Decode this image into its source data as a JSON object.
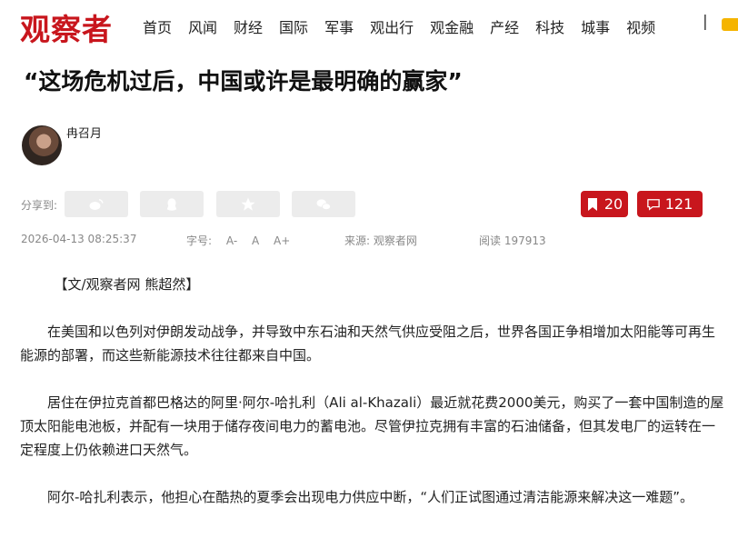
{
  "brand": {
    "logo_text": "观察者",
    "accent": "#c8161d"
  },
  "nav": {
    "items": [
      "首页",
      "风闻",
      "财经",
      "国际",
      "军事",
      "观出行",
      "观金融",
      "产经",
      "科技",
      "城事",
      "视频"
    ],
    "separator": "|"
  },
  "article": {
    "title": "“这场危机过后，中国或许是最明确的赢家”",
    "author": "冉召月",
    "share_label": "分享到:",
    "share_icons": [
      "weibo-icon",
      "qq-icon",
      "qzone-icon",
      "wechat-icon"
    ],
    "bookmark_count": "20",
    "comment_count": "121",
    "date": "2026-04-13 08:25:37",
    "font_size_label": "字号:",
    "font_sizes": [
      "A-",
      "A",
      "A+"
    ],
    "source_label": "来源:",
    "source": "观察者网",
    "reads_label": "阅读",
    "reads": "197913",
    "paragraphs": [
      "【文/观察者网 熊超然】",
      "在美国和以色列对伊朗发动战争，并导致中东石油和天然气供应受阻之后，世界各国正争相增加太阳能等可再生能源的部署，而这些新能源技术往往都来自中国。",
      "居住在伊拉克首都巴格达的阿里·阿尔-哈扎利（Ali al-Khazali）最近就花费2000美元，购买了一套中国制造的屋顶太阳能电池板，并配有一块用于储存夜间电力的蓄电池。尽管伊拉克拥有丰富的石油储备，但其发电厂的运转在一定程度上仍依赖进口天然气。",
      "阿尔-哈扎利表示，他担心在酷热的夏季会出现电力供应中断，“人们正试图通过清洁能源来解决这一难题”。"
    ]
  }
}
